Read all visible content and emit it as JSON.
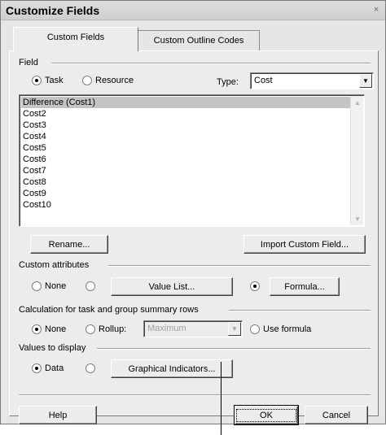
{
  "window": {
    "title": "Customize Fields",
    "close_glyph": "×"
  },
  "tabs": [
    {
      "label": "Custom Fields",
      "active": true
    },
    {
      "label": "Custom Outline Codes",
      "active": false
    }
  ],
  "field": {
    "group_label": "Field",
    "task_label": "Task",
    "resource_label": "Resource",
    "selected": "Task",
    "type_label": "Type:",
    "type_value": "Cost"
  },
  "list": {
    "items": [
      "Difference (Cost1)",
      "Cost2",
      "Cost3",
      "Cost4",
      "Cost5",
      "Cost6",
      "Cost7",
      "Cost8",
      "Cost9",
      "Cost10"
    ],
    "selected_index": 0
  },
  "buttons": {
    "rename": "Rename...",
    "import": "Import Custom Field...",
    "value_list": "Value List...",
    "formula": "Formula...",
    "graphical": "Graphical Indicators...",
    "help": "Help",
    "ok": "OK",
    "cancel": "Cancel"
  },
  "custom_attributes": {
    "group_label": "Custom attributes",
    "none_label": "None",
    "selected": "Formula"
  },
  "calculation": {
    "group_label": "Calculation for task and group summary rows",
    "none_label": "None",
    "rollup_label": "Rollup:",
    "rollup_value": "Maximum",
    "use_formula_label": "Use formula",
    "selected": "None"
  },
  "values_display": {
    "group_label": "Values to display",
    "data_label": "Data",
    "selected": "Data"
  },
  "icons": {
    "dropdown": "chevron-down-icon",
    "scroll_up": "chevron-up-icon",
    "scroll_down": "chevron-down-icon",
    "close": "close-icon"
  },
  "colors": {
    "dialog_bg": "#ececec",
    "selection": "#c4c4c4"
  }
}
